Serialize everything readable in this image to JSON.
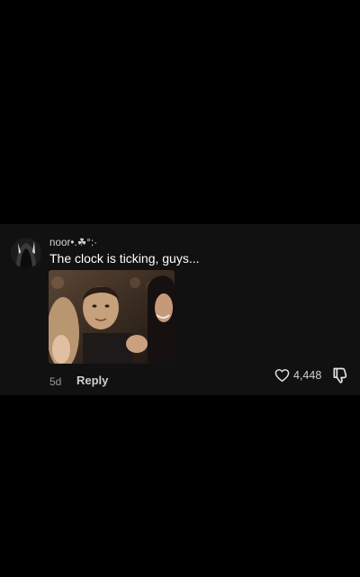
{
  "comment": {
    "username": "noor•.☘°:·",
    "text": "The clock is ticking, guys...",
    "time": "5d",
    "reply_label": "Reply",
    "like_count": "4,448",
    "media_name": "audience-clapping-gif"
  },
  "icons": {
    "like": "heart-icon",
    "dislike": "thumbs-down-icon"
  },
  "colors": {
    "background": "#000000",
    "card": "#111112",
    "text_primary": "#ffffff",
    "text_secondary": "#9a9a9a"
  }
}
